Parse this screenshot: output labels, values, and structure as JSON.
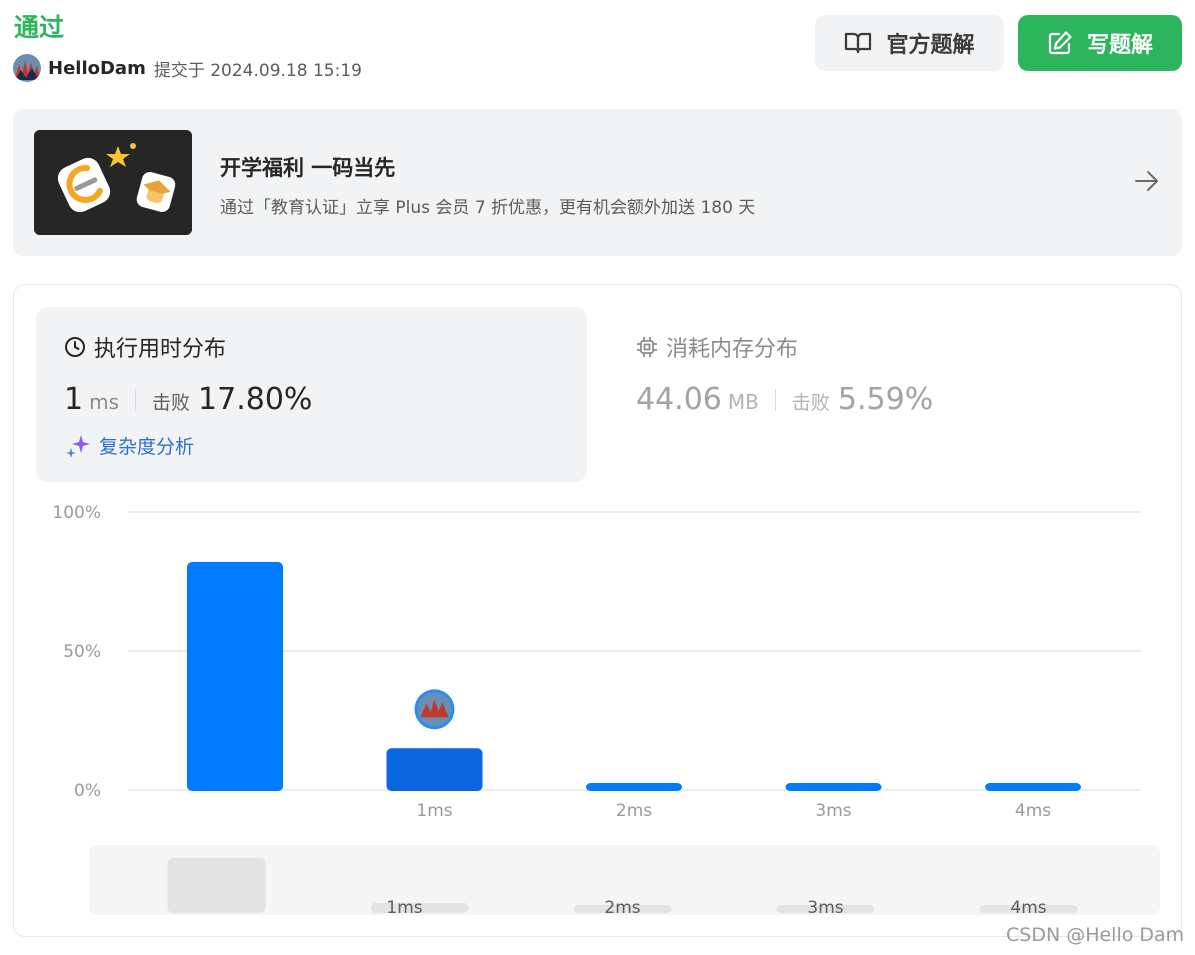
{
  "header": {
    "status": "通过",
    "username": "HelloDam",
    "submitted_at": "提交于 2024.09.18 15:19",
    "official_solution_label": "官方题解",
    "write_solution_label": "写题解"
  },
  "banner": {
    "title": "开学福利 一码当先",
    "subtitle": "通过「教育认证」立享 Plus 会员 7 折优惠，更有机会额外加送 180 天"
  },
  "runtime": {
    "title": "执行用时分布",
    "value": "1",
    "unit": "ms",
    "beat_label": "击败",
    "beat_value": "17.80%",
    "complexity_label": "复杂度分析"
  },
  "memory": {
    "title": "消耗内存分布",
    "value": "44.06",
    "unit": "MB",
    "beat_label": "击败",
    "beat_value": "5.59%"
  },
  "colors": {
    "accent_green": "#2db55d",
    "bar_blue": "#007aff",
    "bar_selected": "#0a67e0",
    "minimap_bar": "#e3e3e3"
  },
  "chart_data": {
    "type": "bar",
    "categories": [
      "",
      "1ms",
      "2ms",
      "3ms",
      "4ms"
    ],
    "values": [
      82,
      15,
      2.5,
      2.5,
      2.5
    ],
    "selected_index": 1,
    "ylim": [
      0,
      100
    ],
    "yticks": [
      "0%",
      "50%",
      "100%"
    ],
    "grid": true
  },
  "watermark": "CSDN @Hello Dam"
}
